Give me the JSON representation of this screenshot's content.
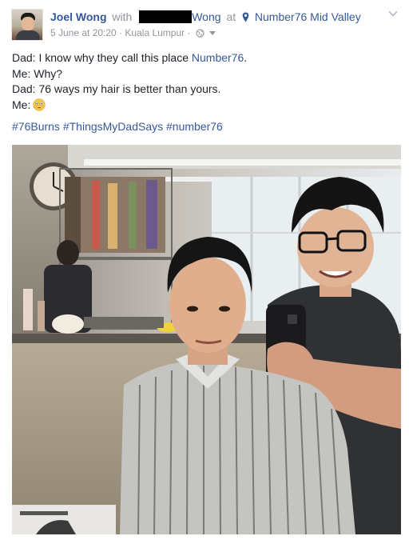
{
  "post": {
    "author": "Joel Wong",
    "with_label": "with",
    "tagged_visible": "Wong",
    "at_label": "at",
    "location": "Number76 Mid Valley",
    "timestamp": "5 June at 20:20",
    "place_meta": "Kuala Lumpur",
    "separator": "·",
    "icons": [
      "location-pin-icon",
      "globe-icon",
      "audience-dropdown-icon",
      "options-chevron-icon",
      "flushed-emoji-icon"
    ],
    "text_lines": [
      {
        "prefix": "Dad: I know why they call this place ",
        "link": "Number76",
        "suffix": "."
      },
      {
        "text": "Me: Why?"
      },
      {
        "text": "Dad: 76 ways my hair is better than yours."
      },
      {
        "text": "Me:"
      }
    ],
    "hashtags": [
      "#76Burns",
      "#ThingsMyDadSays",
      "#number76"
    ],
    "colors": {
      "link": "#365899",
      "meta": "#90949c",
      "text": "#1d2129"
    }
  }
}
